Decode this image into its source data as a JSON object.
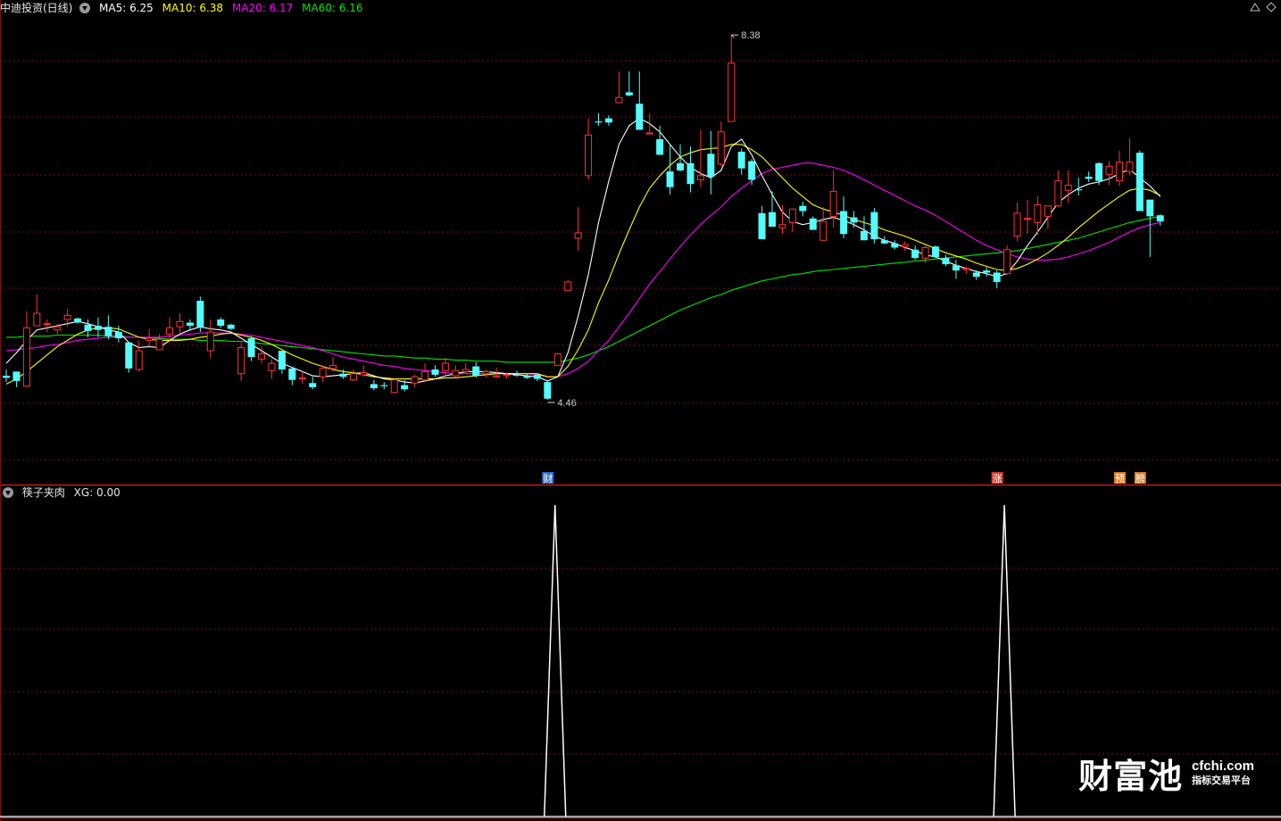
{
  "header": {
    "title": "中迪投资(日线)",
    "ma5_label": "MA5: 6.25",
    "ma10_label": "MA10: 6.38",
    "ma20_label": "MA20: 6.17",
    "ma60_label": "MA60: 6.16"
  },
  "indicator": {
    "title": "筷子夹肉",
    "xg_label": "XG: 0.00"
  },
  "annotations": {
    "high_label": "8.38",
    "low_label": "4.46"
  },
  "event_markers": [
    {
      "label": "财",
      "index": 53
    },
    {
      "label": "涨",
      "index": 97
    },
    {
      "label": "预",
      "index": 109
    },
    {
      "label": "膀",
      "index": 111
    }
  ],
  "watermark": {
    "brand": "财富池",
    "url": "cfchi.com",
    "tagline": "指标交易平台"
  },
  "colors": {
    "background": "#000000",
    "up": "#ff3232",
    "down": "#54fcfc",
    "ma5": "#ffffff",
    "ma10": "#ffff00",
    "ma20": "#ff00ff",
    "ma60": "#00e600",
    "grid": "#7a1010",
    "divider": "#ff2020",
    "xg_line": "#ffffff",
    "title": "#e8e8e8"
  },
  "chart_data": {
    "type": "candlestick",
    "y_range": [
      4.25,
      8.6
    ],
    "count": 114,
    "candles": [
      [
        5.08,
        5.14,
        5.02,
        5.06
      ],
      [
        5.12,
        5.12,
        4.97,
        5.03
      ],
      [
        4.98,
        5.7,
        4.98,
        5.54
      ],
      [
        5.56,
        5.86,
        5.56,
        5.68
      ],
      [
        5.58,
        5.62,
        5.5,
        5.58
      ],
      [
        5.52,
        5.58,
        5.48,
        5.55
      ],
      [
        5.62,
        5.72,
        5.55,
        5.66
      ],
      [
        5.63,
        5.64,
        5.58,
        5.59
      ],
      [
        5.57,
        5.62,
        5.45,
        5.51
      ],
      [
        5.56,
        5.64,
        5.45,
        5.52
      ],
      [
        5.55,
        5.66,
        5.43,
        5.46
      ],
      [
        5.5,
        5.56,
        5.4,
        5.44
      ],
      [
        5.4,
        5.4,
        5.11,
        5.15
      ],
      [
        5.14,
        5.42,
        5.12,
        5.32
      ],
      [
        5.42,
        5.53,
        5.36,
        5.44
      ],
      [
        5.33,
        5.48,
        5.33,
        5.43
      ],
      [
        5.48,
        5.64,
        5.4,
        5.54
      ],
      [
        5.55,
        5.68,
        5.49,
        5.6
      ],
      [
        5.59,
        5.62,
        5.51,
        5.56
      ],
      [
        5.8,
        5.84,
        5.5,
        5.54
      ],
      [
        5.32,
        5.62,
        5.25,
        5.5
      ],
      [
        5.62,
        5.64,
        5.54,
        5.56
      ],
      [
        5.57,
        5.58,
        5.52,
        5.53
      ],
      [
        5.1,
        5.4,
        5.03,
        5.35
      ],
      [
        5.44,
        5.46,
        5.22,
        5.26
      ],
      [
        5.24,
        5.36,
        5.2,
        5.29
      ],
      [
        5.13,
        5.24,
        5.05,
        5.2
      ],
      [
        5.32,
        5.32,
        5.1,
        5.14
      ],
      [
        5.15,
        5.16,
        4.99,
        5.04
      ],
      [
        5.05,
        5.12,
        5.0,
        5.06
      ],
      [
        5.01,
        5.07,
        4.95,
        4.97
      ],
      [
        5.07,
        5.18,
        5.02,
        5.15
      ],
      [
        5.15,
        5.26,
        5.12,
        5.18
      ],
      [
        5.1,
        5.14,
        5.05,
        5.07
      ],
      [
        5.04,
        5.14,
        5.03,
        5.1
      ],
      [
        5.09,
        5.18,
        5.07,
        5.11
      ],
      [
        5.0,
        5.04,
        4.94,
        4.96
      ],
      [
        4.99,
        5.02,
        4.95,
        4.98
      ],
      [
        4.92,
        5.06,
        4.91,
        5.04
      ],
      [
        4.99,
        5.04,
        4.93,
        4.95
      ],
      [
        5.01,
        5.09,
        4.97,
        5.07
      ],
      [
        5.04,
        5.2,
        5.02,
        5.12
      ],
      [
        5.14,
        5.18,
        5.07,
        5.09
      ],
      [
        5.13,
        5.25,
        5.09,
        5.2
      ],
      [
        5.08,
        5.18,
        5.06,
        5.13
      ],
      [
        5.12,
        5.2,
        5.1,
        5.14
      ],
      [
        5.17,
        5.21,
        5.06,
        5.08
      ],
      [
        5.1,
        5.14,
        5.06,
        5.12
      ],
      [
        5.07,
        5.16,
        5.06,
        5.08
      ],
      [
        5.08,
        5.11,
        5.05,
        5.09
      ],
      [
        5.09,
        5.13,
        5.07,
        5.08
      ],
      [
        5.08,
        5.1,
        5.05,
        5.06
      ],
      [
        5.09,
        5.1,
        5.03,
        5.05
      ],
      [
        5.02,
        5.03,
        4.85,
        4.86
      ],
      [
        5.18,
        5.3,
        5.18,
        5.29
      ],
      [
        5.9,
        6.0,
        5.9,
        5.98
      ],
      [
        6.4,
        6.7,
        6.28,
        6.45
      ],
      [
        7.0,
        7.55,
        6.96,
        7.39
      ],
      [
        7.52,
        7.6,
        7.48,
        7.51
      ],
      [
        7.55,
        7.58,
        7.48,
        7.51
      ],
      [
        7.7,
        8.0,
        7.73,
        7.75
      ],
      [
        7.8,
        8.0,
        7.76,
        7.77
      ],
      [
        7.69,
        8.0,
        7.5,
        7.44
      ],
      [
        7.4,
        7.6,
        7.4,
        7.41
      ],
      [
        7.35,
        7.48,
        7.2,
        7.2
      ],
      [
        7.04,
        7.3,
        6.82,
        6.89
      ],
      [
        7.12,
        7.3,
        7.04,
        7.05
      ],
      [
        7.12,
        7.28,
        6.84,
        6.92
      ],
      [
        6.96,
        7.44,
        6.89,
        7.0
      ],
      [
        7.21,
        7.43,
        6.82,
        6.99
      ],
      [
        7.11,
        7.52,
        7.09,
        7.42
      ],
      [
        7.52,
        8.35,
        7.56,
        8.08
      ],
      [
        7.23,
        7.26,
        7.01,
        7.07
      ],
      [
        7.14,
        7.16,
        6.91,
        6.96
      ],
      [
        6.64,
        6.71,
        6.41,
        6.39
      ],
      [
        6.65,
        6.85,
        6.53,
        6.51
      ],
      [
        6.5,
        6.72,
        6.44,
        6.53
      ],
      [
        6.55,
        6.66,
        6.46,
        6.68
      ],
      [
        6.71,
        6.75,
        6.61,
        6.66
      ],
      [
        6.59,
        6.61,
        6.48,
        6.48
      ],
      [
        6.38,
        6.7,
        6.38,
        6.56
      ],
      [
        6.61,
        7.05,
        6.5,
        6.85
      ],
      [
        6.66,
        6.8,
        6.4,
        6.44
      ],
      [
        6.6,
        6.66,
        6.5,
        6.55
      ],
      [
        6.47,
        6.61,
        6.4,
        6.38
      ],
      [
        6.65,
        6.69,
        6.35,
        6.39
      ],
      [
        6.38,
        6.42,
        6.34,
        6.35
      ],
      [
        6.35,
        6.38,
        6.29,
        6.31
      ],
      [
        6.32,
        6.37,
        6.28,
        6.34
      ],
      [
        6.29,
        6.33,
        6.19,
        6.21
      ],
      [
        6.21,
        6.33,
        6.16,
        6.31
      ],
      [
        6.32,
        6.33,
        6.21,
        6.22
      ],
      [
        6.21,
        6.24,
        6.13,
        6.15
      ],
      [
        6.14,
        6.19,
        6.01,
        6.09
      ],
      [
        6.1,
        6.13,
        6.06,
        6.11
      ],
      [
        6.07,
        6.09,
        6.0,
        6.03
      ],
      [
        6.09,
        6.12,
        6.03,
        6.07
      ],
      [
        6.07,
        6.09,
        5.92,
        5.98
      ],
      [
        6.06,
        6.33,
        6.05,
        6.29
      ],
      [
        6.42,
        6.74,
        6.37,
        6.64
      ],
      [
        6.58,
        6.77,
        6.44,
        6.59
      ],
      [
        6.55,
        6.8,
        6.43,
        6.72
      ],
      [
        6.61,
        6.7,
        6.49,
        6.71
      ],
      [
        6.71,
        7.05,
        6.7,
        6.95
      ],
      [
        6.86,
        7.05,
        6.74,
        6.91
      ],
      [
        6.87,
        6.98,
        6.81,
        6.86
      ],
      [
        6.99,
        7.04,
        6.94,
        6.97
      ],
      [
        7.12,
        7.13,
        6.91,
        6.95
      ],
      [
        7.01,
        7.14,
        6.91,
        7.09
      ],
      [
        6.95,
        7.24,
        6.9,
        7.13
      ],
      [
        7.04,
        7.36,
        7.01,
        7.13
      ],
      [
        7.22,
        7.24,
        6.97,
        6.66
      ],
      [
        6.77,
        6.77,
        6.22,
        6.61
      ],
      [
        6.62,
        6.63,
        6.52,
        6.56
      ]
    ],
    "ma5": [
      5.2,
      5.3,
      5.42,
      5.52,
      5.54,
      5.56,
      5.58,
      5.6,
      5.58,
      5.55,
      5.52,
      5.5,
      5.4,
      5.35,
      5.36,
      5.35,
      5.42,
      5.48,
      5.52,
      5.55,
      5.53,
      5.52,
      5.5,
      5.44,
      5.38,
      5.32,
      5.26,
      5.2,
      5.16,
      5.12,
      5.08,
      5.07,
      5.08,
      5.09,
      5.1,
      5.11,
      5.08,
      5.05,
      5.04,
      5.02,
      5.01,
      5.03,
      5.05,
      5.08,
      5.1,
      5.12,
      5.12,
      5.12,
      5.11,
      5.1,
      5.09,
      5.08,
      5.07,
      5.03,
      5.07,
      5.3,
      5.65,
      6.05,
      6.55,
      6.95,
      7.3,
      7.48,
      7.55,
      7.5,
      7.42,
      7.3,
      7.18,
      7.08,
      7.02,
      6.98,
      7.05,
      7.28,
      7.35,
      7.2,
      7.0,
      6.82,
      6.65,
      6.56,
      6.53,
      6.55,
      6.58,
      6.6,
      6.57,
      6.53,
      6.48,
      6.42,
      6.38,
      6.35,
      6.31,
      6.28,
      6.24,
      6.22,
      6.18,
      6.14,
      6.11,
      6.08,
      6.06,
      6.03,
      6.06,
      6.18,
      6.33,
      6.46,
      6.6,
      6.74,
      6.82,
      6.88,
      6.92,
      6.94,
      6.97,
      7.02,
      7.06,
      6.98,
      6.9,
      6.8
    ],
    "ma10": [
      5.0,
      5.05,
      5.12,
      5.2,
      5.28,
      5.36,
      5.42,
      5.48,
      5.52,
      5.54,
      5.54,
      5.53,
      5.49,
      5.45,
      5.43,
      5.42,
      5.42,
      5.42,
      5.43,
      5.45,
      5.46,
      5.48,
      5.49,
      5.47,
      5.45,
      5.42,
      5.38,
      5.33,
      5.28,
      5.24,
      5.2,
      5.17,
      5.14,
      5.12,
      5.11,
      5.09,
      5.07,
      5.06,
      5.05,
      5.05,
      5.05,
      5.05,
      5.05,
      5.06,
      5.06,
      5.07,
      5.08,
      5.09,
      5.1,
      5.1,
      5.1,
      5.1,
      5.1,
      5.07,
      5.07,
      5.17,
      5.33,
      5.52,
      5.78,
      6.0,
      6.25,
      6.48,
      6.7,
      6.88,
      7.0,
      7.1,
      7.18,
      7.22,
      7.25,
      7.26,
      7.27,
      7.3,
      7.3,
      7.25,
      7.18,
      7.08,
      6.98,
      6.88,
      6.8,
      6.72,
      6.68,
      6.65,
      6.62,
      6.58,
      6.55,
      6.52,
      6.48,
      6.45,
      6.42,
      6.38,
      6.34,
      6.3,
      6.26,
      6.23,
      6.2,
      6.16,
      6.13,
      6.1,
      6.09,
      6.11,
      6.15,
      6.2,
      6.26,
      6.33,
      6.41,
      6.5,
      6.58,
      6.66,
      6.73,
      6.8,
      6.86,
      6.88,
      6.86,
      6.81
    ],
    "ma20": [
      5.32,
      5.33,
      5.34,
      5.35,
      5.37,
      5.38,
      5.4,
      5.42,
      5.43,
      5.44,
      5.45,
      5.45,
      5.45,
      5.45,
      5.45,
      5.45,
      5.46,
      5.47,
      5.48,
      5.49,
      5.49,
      5.49,
      5.49,
      5.48,
      5.47,
      5.45,
      5.43,
      5.41,
      5.39,
      5.37,
      5.35,
      5.32,
      5.29,
      5.26,
      5.24,
      5.22,
      5.2,
      5.18,
      5.17,
      5.15,
      5.14,
      5.13,
      5.12,
      5.11,
      5.1,
      5.1,
      5.1,
      5.1,
      5.1,
      5.1,
      5.1,
      5.1,
      5.09,
      5.07,
      5.07,
      5.1,
      5.15,
      5.22,
      5.32,
      5.42,
      5.55,
      5.68,
      5.82,
      5.96,
      6.08,
      6.2,
      6.32,
      6.43,
      6.53,
      6.62,
      6.7,
      6.8,
      6.88,
      6.95,
      7.02,
      7.06,
      7.08,
      7.1,
      7.12,
      7.12,
      7.1,
      7.08,
      7.05,
      7.01,
      6.96,
      6.91,
      6.86,
      6.81,
      6.76,
      6.71,
      6.67,
      6.62,
      6.56,
      6.5,
      6.44,
      6.38,
      6.33,
      6.29,
      6.25,
      6.22,
      6.2,
      6.19,
      6.19,
      6.2,
      6.22,
      6.25,
      6.28,
      6.32,
      6.36,
      6.41,
      6.46,
      6.5,
      6.53,
      6.55
    ],
    "ma60": [
      5.45,
      5.45,
      5.46,
      5.46,
      5.46,
      5.47,
      5.47,
      5.47,
      5.47,
      5.47,
      5.46,
      5.46,
      5.45,
      5.45,
      5.44,
      5.44,
      5.43,
      5.43,
      5.43,
      5.42,
      5.42,
      5.42,
      5.41,
      5.41,
      5.4,
      5.39,
      5.38,
      5.37,
      5.36,
      5.35,
      5.34,
      5.33,
      5.32,
      5.31,
      5.3,
      5.29,
      5.28,
      5.27,
      5.27,
      5.26,
      5.25,
      5.25,
      5.24,
      5.24,
      5.23,
      5.23,
      5.22,
      5.22,
      5.22,
      5.21,
      5.21,
      5.21,
      5.21,
      5.21,
      5.21,
      5.23,
      5.25,
      5.28,
      5.32,
      5.36,
      5.41,
      5.46,
      5.51,
      5.56,
      5.61,
      5.66,
      5.71,
      5.75,
      5.79,
      5.83,
      5.86,
      5.9,
      5.93,
      5.96,
      5.99,
      6.01,
      6.03,
      6.05,
      6.06,
      6.08,
      6.09,
      6.1,
      6.11,
      6.12,
      6.13,
      6.14,
      6.15,
      6.16,
      6.17,
      6.18,
      6.19,
      6.2,
      6.21,
      6.22,
      6.23,
      6.24,
      6.25,
      6.26,
      6.27,
      6.28,
      6.3,
      6.32,
      6.34,
      6.36,
      6.38,
      6.4,
      6.43,
      6.46,
      6.49,
      6.52,
      6.55,
      6.57,
      6.59,
      6.61
    ],
    "xg_signal_indices": [
      54,
      98
    ],
    "xg_range": [
      0,
      1
    ]
  }
}
